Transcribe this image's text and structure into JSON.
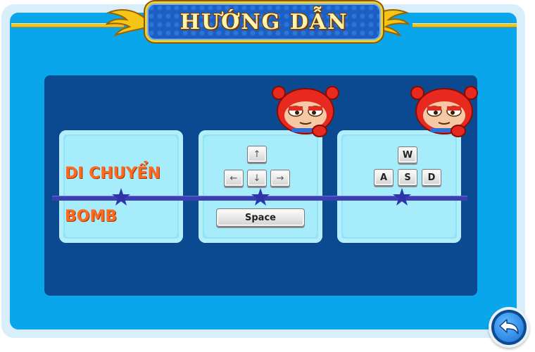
{
  "header": {
    "title": "HƯỚNG DẪN"
  },
  "controls": {
    "move_label": "DI CHUYỂN",
    "bomb_label": "BOMB",
    "player1": {
      "arrow_keys": [
        "↑",
        "←",
        "↓",
        "→"
      ],
      "bomb_key": "Space"
    },
    "player2": {
      "letter_keys": [
        "W",
        "A",
        "S",
        "D"
      ]
    }
  },
  "icons": {
    "back": "back-arrow-icon",
    "mascot": "red-mascot-icon",
    "star": "star-icon"
  },
  "colors": {
    "frame_blue": "#0aa6ec",
    "panel_navy": "#0b4a91",
    "label_orange": "#ff6a1e",
    "gold": "#f2c21c"
  }
}
